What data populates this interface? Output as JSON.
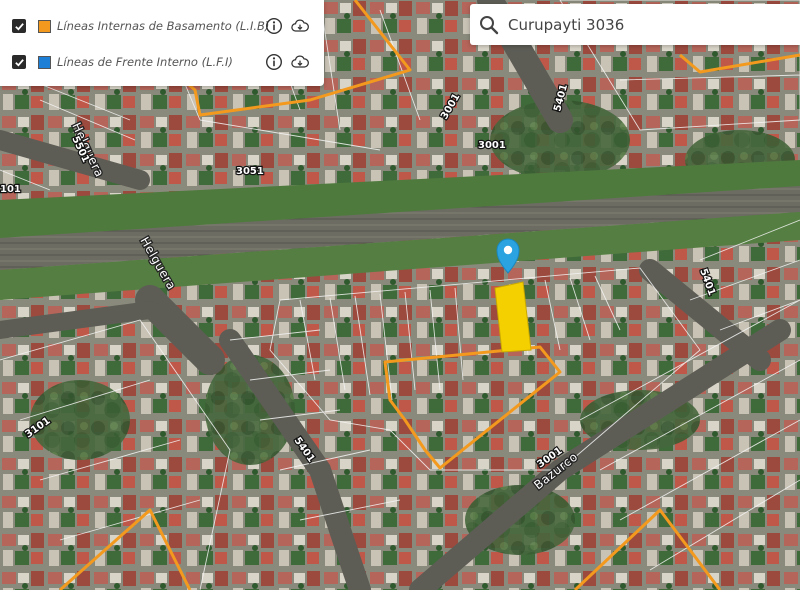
{
  "layers": [
    {
      "label": "Líneas Internas de Basamento (L.I.B)",
      "checked": true,
      "swatch_color": "#f39a1e"
    },
    {
      "label": "Líneas de Frente Interno (L.F.I)",
      "checked": true,
      "swatch_color": "#1e7fd6"
    }
  ],
  "search": {
    "value": "Curupayti 3036",
    "placeholder": ""
  },
  "map": {
    "street_labels": [
      "Helguera",
      "Helguera",
      "Bazurco"
    ],
    "house_numbers": [
      "5501",
      "3001",
      "5401",
      "3001",
      "3051",
      "3101",
      "5401",
      "5401",
      "3001",
      "101"
    ],
    "colors": {
      "lib_line": "#f39a1e",
      "selected_parcel": "#f5d000",
      "marker": "#2aa3e0",
      "parcel_outline": "#f4f4f4"
    }
  }
}
